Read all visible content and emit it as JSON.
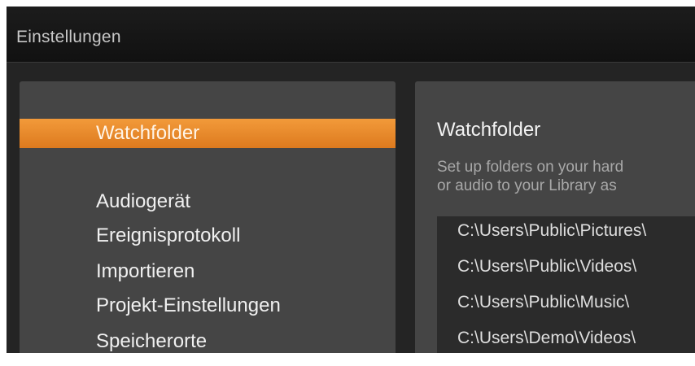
{
  "window": {
    "title": "Einstellungen"
  },
  "sidebar": {
    "items": [
      {
        "label": "Watchfolder",
        "selected": true
      },
      {
        "label": "Audiogerät",
        "selected": false
      },
      {
        "label": "Ereignisprotokoll",
        "selected": false
      },
      {
        "label": "Importieren",
        "selected": false
      },
      {
        "label": "Projekt-Einstellungen",
        "selected": false
      },
      {
        "label": "Speicherorte",
        "selected": false
      }
    ]
  },
  "main": {
    "title": "Watchfolder",
    "description_line1": "Set up folders on your hard",
    "description_line2": "or audio to your Library as",
    "folders": [
      "C:\\Users\\Public\\Pictures\\",
      "C:\\Users\\Public\\Videos\\",
      "C:\\Users\\Public\\Music\\",
      "C:\\Users\\Demo\\Videos\\"
    ]
  },
  "colors": {
    "accent": "#E88A2A",
    "panel": "#454545",
    "background": "#242424",
    "list_background": "#2B2B2B"
  }
}
